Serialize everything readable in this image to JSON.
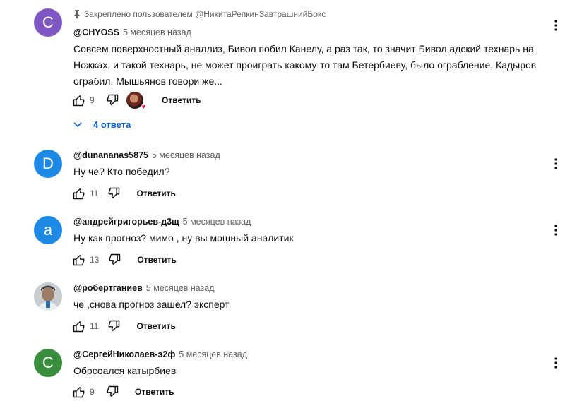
{
  "colors": {
    "accent": "#065fd4",
    "avatar_c1": "#7e57c2",
    "avatar_d": "#1e88e5",
    "avatar_a": "#1e88e5",
    "avatar_c2": "#388e3c"
  },
  "comments": [
    {
      "pinned_label": "Закреплено пользователем @НикитаРепкинЗавтрашнийБокс",
      "avatar_letter": "C",
      "author": "@CHYOSS",
      "time": "5 месяцев назад",
      "text": "Совсем поверхностный аналлиз, Бивол побил Канелу, а раз так, то значит Бивол адский технарь на Ножках, и такой технарь, не может проиграть какому-то там Бетербиеву, было ограбление, Кадыров ограбил, Мышьянов говори же...",
      "likes": "9",
      "reply_label": "Ответить",
      "replies_label": "4 ответа",
      "creator_heart": "creator-heart-avatar"
    },
    {
      "avatar_letter": "D",
      "author": "@dunananas5875",
      "time": "5 месяцев назад",
      "text": "Ну че? Кто победил?",
      "likes": "11",
      "reply_label": "Ответить"
    },
    {
      "avatar_letter": "a",
      "author": "@андрейгригорьев-д3щ",
      "time": "5 месяцев назад",
      "text": "Ну как прогноз? мимо , ну вы мощный аналитик",
      "likes": "13",
      "reply_label": "Ответить"
    },
    {
      "avatar_letter": "",
      "author": "@робертганиев",
      "time": "5 месяцев назад",
      "text": "че ,снова прогноз зашел?  эксперт",
      "likes": "11",
      "reply_label": "Ответить"
    },
    {
      "avatar_letter": "С",
      "author": "@СергейНиколаев-э2ф",
      "time": "5 месяцев назад",
      "text": "Обрсоался катырбиев",
      "likes": "9",
      "reply_label": "Ответить"
    }
  ]
}
